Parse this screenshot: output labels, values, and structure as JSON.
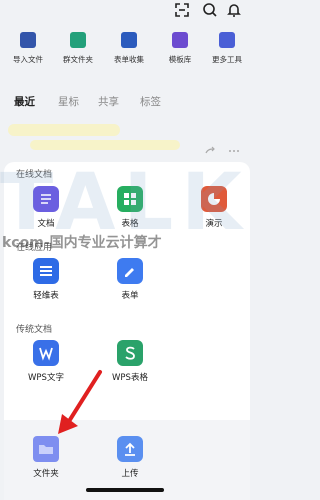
{
  "quick_actions": [
    {
      "label": "导入文件",
      "icon": "import-file-icon",
      "color": "#3355aa"
    },
    {
      "label": "群文件夹",
      "icon": "group-folder-icon",
      "color": "#23a07a"
    },
    {
      "label": "表单收集",
      "icon": "form-collect-icon",
      "color": "#2b5bbd"
    },
    {
      "label": "模板库",
      "icon": "template-icon",
      "color": "#6c4bd0"
    },
    {
      "label": "更多工具",
      "icon": "more-tools-icon",
      "color": "#4a5fd6"
    }
  ],
  "tabs": [
    "最近",
    "星标",
    "共享",
    "标签"
  ],
  "sections": [
    {
      "title": "在线文档",
      "items": [
        {
          "label": "文档",
          "color": "#6b5fe0"
        },
        {
          "label": "表格",
          "color": "#27ae60"
        },
        {
          "label": "演示",
          "color": "#e05a3a"
        }
      ]
    },
    {
      "title": "在线应用",
      "items": [
        {
          "label": "轻维表",
          "color": "#2e6be6"
        },
        {
          "label": "表单",
          "color": "#3e7bf0"
        }
      ]
    },
    {
      "title": "传统文档",
      "items": [
        {
          "label": "WPS文字",
          "color": "#3970e8"
        },
        {
          "label": "WPS表格",
          "color": "#2aa26a"
        }
      ]
    }
  ],
  "bottom_items": [
    {
      "label": "文件夹",
      "color": "#7e8ef0"
    },
    {
      "label": "上传",
      "color": "#5a8ff0"
    }
  ],
  "watermark": {
    "big": "TALK",
    "line": "kcom-国内专业云计算才"
  }
}
